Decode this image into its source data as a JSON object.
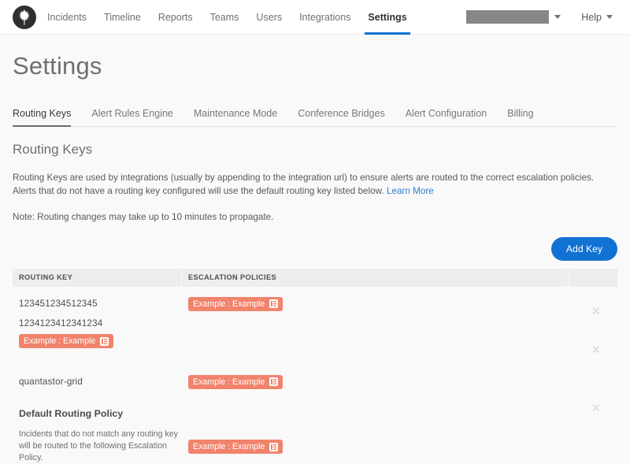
{
  "topnav": {
    "logo_icon": "oak-leaf-logo-icon",
    "links": [
      {
        "label": "Incidents",
        "active": false
      },
      {
        "label": "Timeline",
        "active": false
      },
      {
        "label": "Reports",
        "active": false
      },
      {
        "label": "Teams",
        "active": false
      },
      {
        "label": "Users",
        "active": false
      },
      {
        "label": "Integrations",
        "active": false
      },
      {
        "label": "Settings",
        "active": true
      }
    ],
    "user_menu": {
      "label": "",
      "redacted": true,
      "caret_icon": "chevron-down-icon"
    },
    "help": {
      "label": "Help",
      "caret_icon": "chevron-down-icon"
    }
  },
  "page": {
    "title": "Settings"
  },
  "tabs": [
    {
      "label": "Routing Keys",
      "active": true
    },
    {
      "label": "Alert Rules Engine",
      "active": false
    },
    {
      "label": "Maintenance Mode",
      "active": false
    },
    {
      "label": "Conference Bridges",
      "active": false
    },
    {
      "label": "Alert Configuration",
      "active": false
    },
    {
      "label": "Billing",
      "active": false
    }
  ],
  "section": {
    "title": "Routing Keys",
    "description_pre": "Routing Keys are used by integrations (usually by appending to the integration url) to ensure alerts are routed to the correct escalation policies. Alerts that do not have a routing key configured will use the default routing key listed below. ",
    "learn_more": "Learn More",
    "note": "Note: Routing changes may take up to 10 minutes to propagate."
  },
  "toolbar": {
    "add_key_label": "Add Key"
  },
  "table": {
    "columns": [
      "ROUTING KEY",
      "ESCALATION POLICIES"
    ],
    "badge_icon": "escalation-policy-icon",
    "delete_icon": "close-icon",
    "rows": [
      {
        "key": "123451234512345",
        "policy_label": "Example : Example",
        "policy_in_key_column": false,
        "deletable": true
      },
      {
        "key": "1234123412341234",
        "policy_label": "Example : Example",
        "policy_in_key_column": true,
        "deletable": true
      },
      {
        "key": "quantastor-grid",
        "policy_label": "Example : Example",
        "policy_in_key_column": false,
        "deletable": true
      }
    ]
  },
  "default_policy": {
    "title": "Default Routing Policy",
    "description": "Incidents that do not match any routing key will be routed to the following Escalation Policy.",
    "policy_label": "Example : Example"
  },
  "colors": {
    "accent_blue": "#1172d4",
    "badge_coral": "#f1836c",
    "page_bg": "#f9f9f9",
    "header_row_bg": "#ededed",
    "link_blue": "#2a7ed4"
  }
}
